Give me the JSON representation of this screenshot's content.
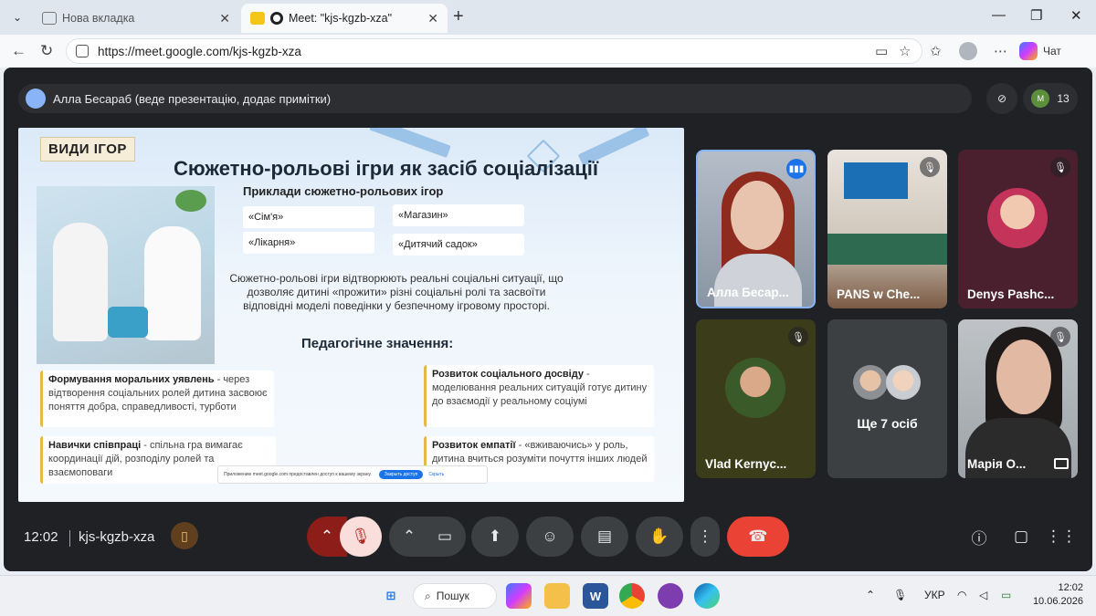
{
  "browser": {
    "tabs": [
      {
        "title": "Нова вкладка",
        "active": false
      },
      {
        "title": "Meet: \"kjs-kgzb-xza\"",
        "active": true
      }
    ],
    "url": "https://meet.google.com/kjs-kgzb-xza",
    "copilot_label": "Чат"
  },
  "meet": {
    "presenter_text": "Алла Бесараб (веде презентацію, додає примітки)",
    "participant_count": "13",
    "people_initials": "M",
    "time": "12:02",
    "meeting_code": "kjs-kgzb-xza"
  },
  "slide": {
    "tag": "ВИДИ ІГОР",
    "title": "Сюжетно-рольові ігри як засіб соціалізації",
    "subtitle": "Приклади сюжетно-рольових ігор",
    "chips": [
      "«Сім'я»",
      "«Магазин»",
      "«Лікарня»",
      "«Дитячий садок»"
    ],
    "paragraph": "Сюжетно-рольові ігри відтворюють реальні соціальні ситуації, що дозволяє дитині «прожити» різні соціальні ролі та засвоїти відповідні моделі поведінки у безпечному ігровому просторі.",
    "section_title": "Педагогічне значення:",
    "cards": [
      {
        "bold": "Формування моральних уявлень",
        "text": " - через відтворення соціальних ролей дитина засвоює поняття добра, справедливості, турботи"
      },
      {
        "bold": "Розвиток соціального досвіду",
        "text": " - моделювання реальних ситуацій готує дитину до взаємодії у реальному соціумі"
      },
      {
        "bold": "Навички співпраці",
        "text": " - спільна гра вимагає координації дій, розподілу ролей та взаємоповаги"
      },
      {
        "bold": "Розвиток емпатії",
        "text": " - «вживаючись» у роль, дитина вчиться розуміти почуття інших людей"
      }
    ],
    "permission_text": "Приложению meet.google.com предоставлен доступ к вашему экрану.",
    "permission_allow": "Закрыть доступ",
    "permission_dismiss": "Скрыть"
  },
  "participants": [
    {
      "name": "Алла Бесар...",
      "state": "speaking"
    },
    {
      "name": "PANS w Che...",
      "state": "muted"
    },
    {
      "name": "Denys Pashc...",
      "state": "muted"
    },
    {
      "name": "Vlad Kernyc...",
      "state": "muted"
    },
    {
      "name": "Ще 7 осіб",
      "state": "group"
    },
    {
      "name": "Марія О...",
      "state": "muted"
    }
  ],
  "taskbar": {
    "search_label": "Пошук",
    "language": "УКР",
    "time": "12:02",
    "date": "10.06.2026"
  }
}
